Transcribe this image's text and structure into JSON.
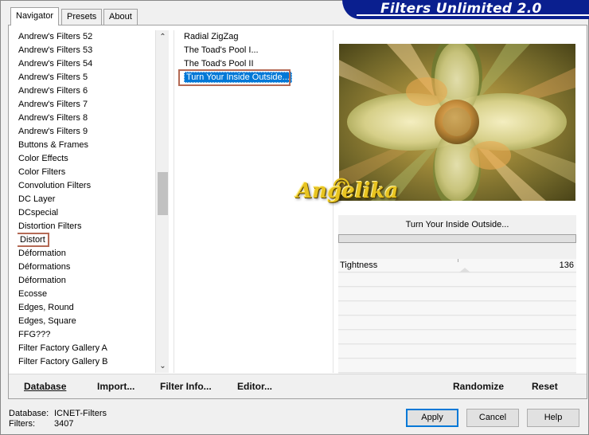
{
  "app": {
    "title": "Filters Unlimited 2.0"
  },
  "tabs": [
    {
      "label": "Navigator",
      "active": true
    },
    {
      "label": "Presets",
      "active": false
    },
    {
      "label": "About",
      "active": false
    }
  ],
  "categories": {
    "items": [
      "Andrew's Filters 52",
      "Andrew's Filters 53",
      "Andrew's Filters 54",
      "Andrew's Filters 5",
      "Andrew's Filters 6",
      "Andrew's Filters 7",
      "Andrew's Filters 8",
      "Andrew's Filters 9",
      "Buttons & Frames",
      "Color Effects",
      "Color Filters",
      "Convolution Filters",
      "DC Layer",
      "DCspecial",
      "Distortion Filters",
      "Distort",
      "Déformation",
      "Déformations",
      "Déformation",
      "Ecosse",
      "Edges, Round",
      "Edges, Square",
      "FFG???",
      "Filter Factory Gallery A",
      "Filter Factory Gallery B"
    ],
    "selected_index": 15
  },
  "filters": {
    "items": [
      "Radial ZigZag",
      "The Toad's Pool I...",
      "The Toad's Pool II",
      "Turn Your Inside Outside..."
    ],
    "selected_index": 3
  },
  "preview": {
    "watermark": "Angelika",
    "watermark_symbol": "©"
  },
  "params": {
    "filter_name": "Turn Your Inside Outside...",
    "rows": [
      {
        "label": "Tightness",
        "value": "136"
      }
    ]
  },
  "toolbar": {
    "database_label": "Database",
    "import_label": "Import...",
    "filter_info_label": "Filter Info...",
    "editor_label": "Editor...",
    "randomize_label": "Randomize",
    "reset_label": "Reset"
  },
  "status": {
    "database_label": "Database:",
    "database_value": "ICNET-Filters",
    "filters_label": "Filters:",
    "filters_value": "3407"
  },
  "buttons": {
    "apply": "Apply",
    "cancel": "Cancel",
    "help": "Help"
  },
  "colors": {
    "banner": "#0a1f8f",
    "selection": "#0078d7",
    "highlight_frame": "#b46a55"
  }
}
